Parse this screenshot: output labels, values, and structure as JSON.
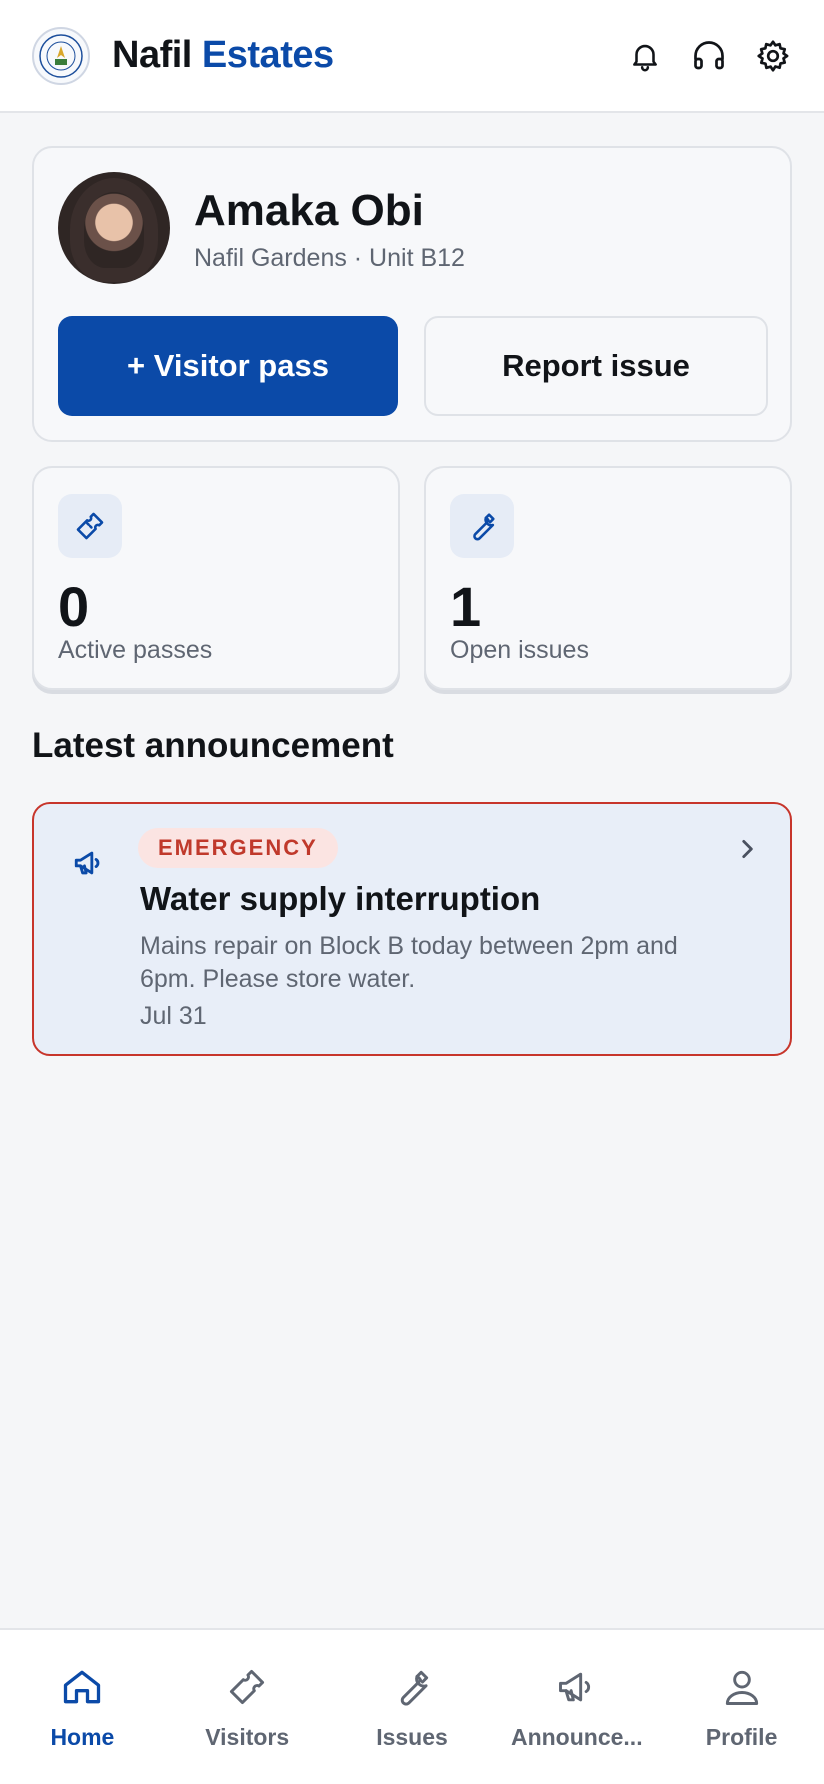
{
  "header": {
    "brand_first": "Nafil",
    "brand_second": "Estates",
    "logo_icon": "nigerian-air-force-seal"
  },
  "profile": {
    "name": "Amaka Obi",
    "subtitle": "Nafil Gardens · Unit B12",
    "primary_action": "+ Visitor pass",
    "secondary_action": "Report issue"
  },
  "stats": [
    {
      "value": "0",
      "label": "Active passes",
      "icon": "ticket-icon"
    },
    {
      "value": "1",
      "label": "Open issues",
      "icon": "wrench-icon"
    }
  ],
  "section": {
    "title": "Latest announcement"
  },
  "announcement": {
    "badge": "EMERGENCY",
    "title": "Water supply interruption",
    "body": "Mains repair on Block B today between 2pm and 6pm. Please store water.",
    "date": "Jul 31",
    "icon": "megaphone-icon"
  },
  "nav": [
    {
      "label": "Home",
      "active": true
    },
    {
      "label": "Visitors",
      "active": false
    },
    {
      "label": "Issues",
      "active": false
    },
    {
      "label": "Announce...",
      "active": false
    },
    {
      "label": "Profile",
      "active": false
    }
  ],
  "colors": {
    "brand": "#0b4aa8",
    "emergency": "#c0392b",
    "background": "#f5f6f8"
  }
}
